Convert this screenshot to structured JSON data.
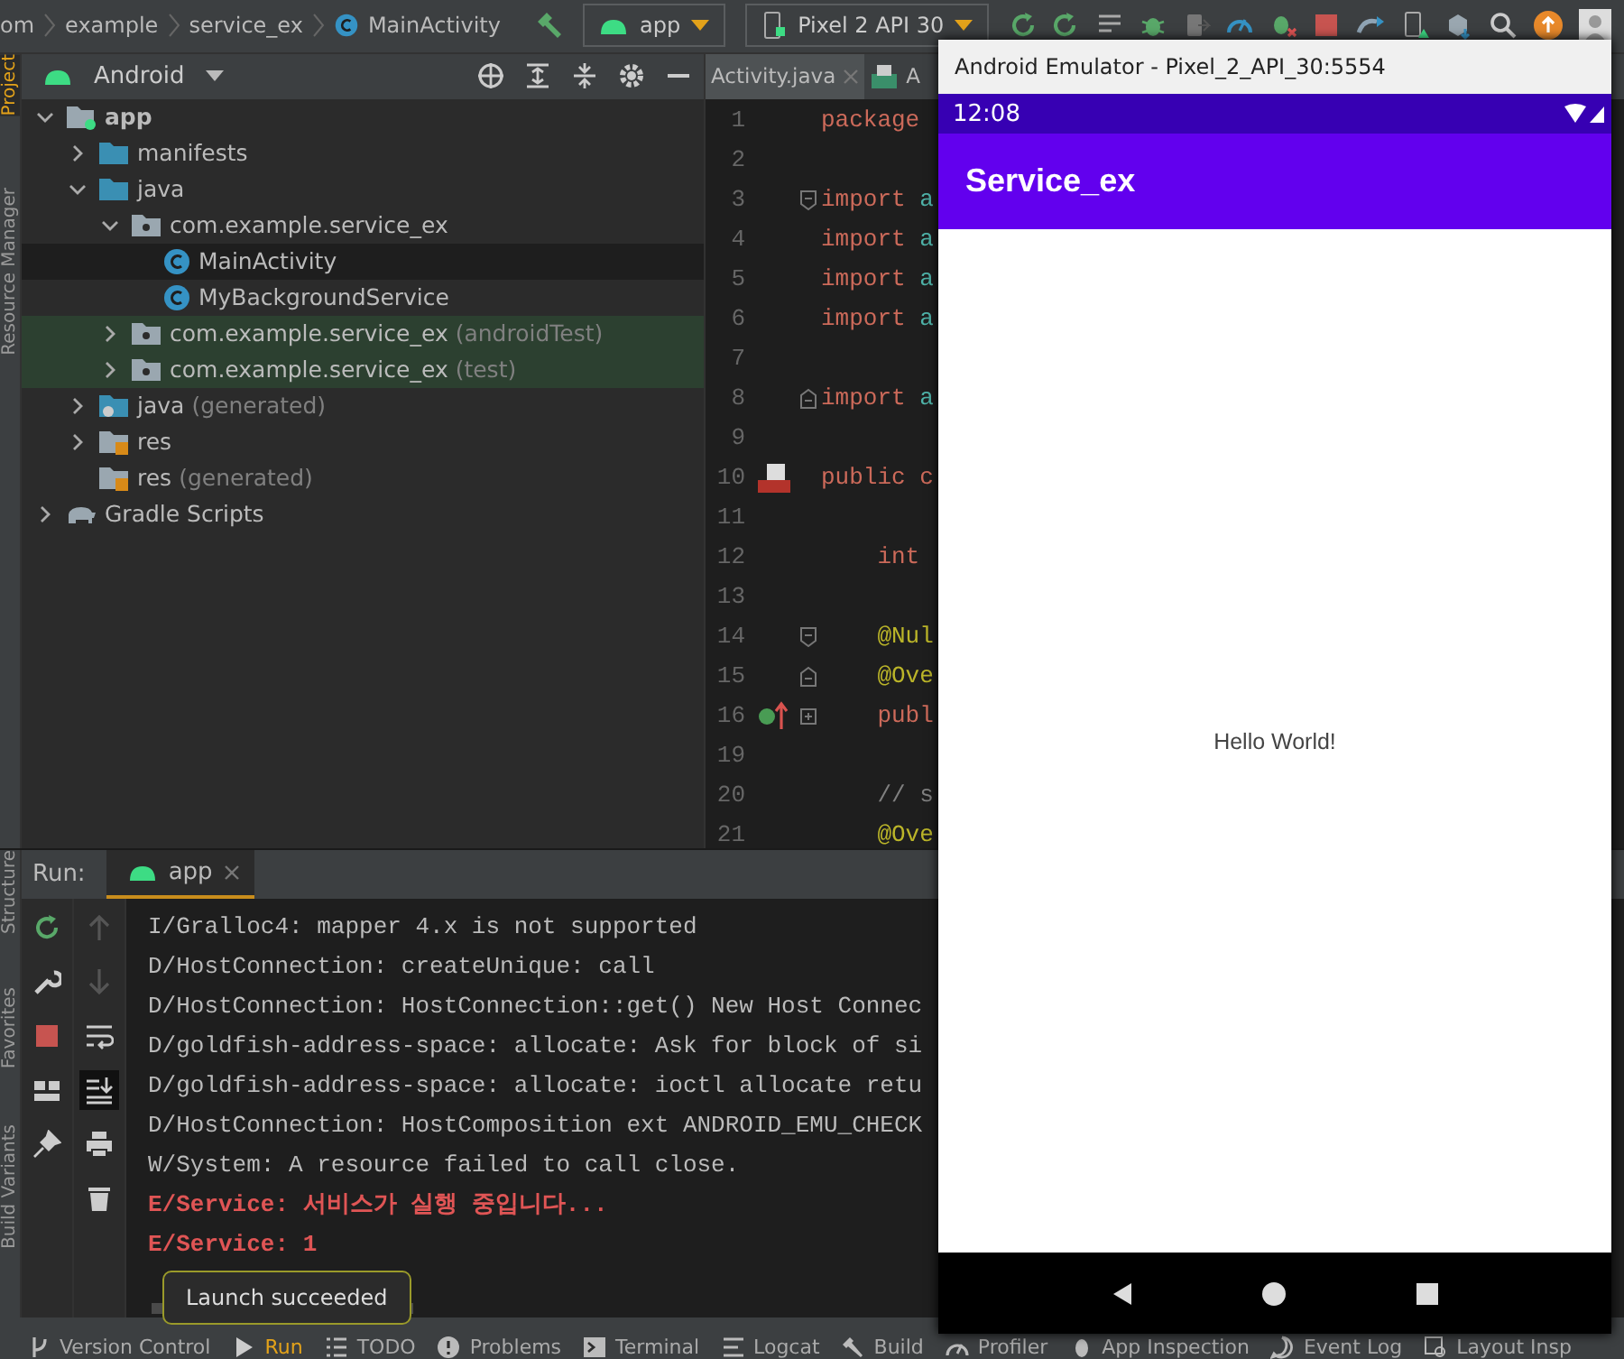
{
  "breadcrumbs": [
    "om",
    "example",
    "service_ex",
    "MainActivity"
  ],
  "run_config": {
    "label": "app"
  },
  "device": {
    "label": "Pixel 2 API 30"
  },
  "left_stripe": [
    {
      "label": "Project",
      "selected": true
    },
    {
      "label": "Resource Manager",
      "selected": false
    }
  ],
  "project": {
    "view": "Android",
    "tree": [
      {
        "label": "app",
        "kind": "module",
        "expanded": true,
        "selected": false,
        "tinted": false,
        "children": [
          {
            "label": "manifests",
            "kind": "folder",
            "expanded": false,
            "selected": false,
            "tinted": false
          },
          {
            "label": "java",
            "kind": "folder",
            "expanded": true,
            "selected": false,
            "tinted": false,
            "children": [
              {
                "label": "com.example.service_ex",
                "kind": "package",
                "expanded": true,
                "selected": false,
                "tinted": false,
                "children": [
                  {
                    "label": "MainActivity",
                    "kind": "class",
                    "selected": true,
                    "tinted": false
                  },
                  {
                    "label": "MyBackgroundService",
                    "kind": "class",
                    "selected": false,
                    "tinted": false
                  }
                ]
              },
              {
                "label": "com.example.service_ex",
                "suffix": "(androidTest)",
                "kind": "package",
                "expanded": false,
                "selected": false,
                "tinted": true
              },
              {
                "label": "com.example.service_ex",
                "suffix": "(test)",
                "kind": "package",
                "expanded": false,
                "selected": false,
                "tinted": true
              }
            ]
          },
          {
            "label": "java",
            "suffix": "(generated)",
            "kind": "generated",
            "expanded": false,
            "selected": false,
            "tinted": false
          },
          {
            "label": "res",
            "kind": "res",
            "expanded": false,
            "selected": false,
            "tinted": false
          },
          {
            "label": "res",
            "suffix": "(generated)",
            "kind": "res",
            "selected": false,
            "tinted": false
          }
        ]
      },
      {
        "label": "Gradle Scripts",
        "kind": "gradle",
        "expanded": false,
        "selected": false,
        "tinted": false
      }
    ]
  },
  "editor": {
    "tabs": [
      {
        "label": "Activity.java",
        "selected": true
      },
      {
        "label": "A",
        "selected": false
      }
    ],
    "lines": [
      {
        "number": "1",
        "tokens": [
          {
            "kind": "keyword",
            "text": "package"
          }
        ]
      },
      {
        "number": "2"
      },
      {
        "number": "3",
        "markers": [
          {
            "kind": "fold-start"
          }
        ],
        "tokens": [
          {
            "kind": "keyword",
            "text": "import"
          },
          {
            "kind": "ident",
            "text": " a"
          }
        ]
      },
      {
        "number": "4",
        "tokens": [
          {
            "kind": "keyword",
            "text": "import"
          },
          {
            "kind": "ident",
            "text": " a"
          }
        ]
      },
      {
        "number": "5",
        "tokens": [
          {
            "kind": "keyword",
            "text": "import"
          },
          {
            "kind": "ident",
            "text": " a"
          }
        ]
      },
      {
        "number": "6",
        "tokens": [
          {
            "kind": "keyword",
            "text": "import"
          },
          {
            "kind": "ident",
            "text": " a"
          }
        ]
      },
      {
        "number": "7"
      },
      {
        "number": "8",
        "markers": [
          {
            "kind": "fold-end"
          }
        ],
        "tokens": [
          {
            "kind": "keyword",
            "text": "import"
          },
          {
            "kind": "ident",
            "text": " a"
          }
        ]
      },
      {
        "number": "9"
      },
      {
        "number": "10",
        "markers": [
          {
            "kind": "layout"
          }
        ],
        "tokens": [
          {
            "kind": "keyword",
            "text": "public c"
          }
        ]
      },
      {
        "number": "11"
      },
      {
        "number": "12",
        "tokens": [
          {
            "kind": "keyword",
            "text": "    int"
          }
        ]
      },
      {
        "number": "13"
      },
      {
        "number": "14",
        "markers": [
          {
            "kind": "fold-start"
          }
        ],
        "tokens": [
          {
            "kind": "annotation",
            "text": "    @Nul"
          }
        ]
      },
      {
        "number": "15",
        "markers": [
          {
            "kind": "fold-end"
          }
        ],
        "tokens": [
          {
            "kind": "annotation",
            "text": "    @Ove"
          }
        ]
      },
      {
        "number": "16",
        "markers": [
          {
            "kind": "override"
          },
          {
            "kind": "fold-plus"
          }
        ],
        "tokens": [
          {
            "kind": "keyword",
            "text": "    publ"
          }
        ]
      },
      {
        "number": "19"
      },
      {
        "number": "20",
        "tokens": [
          {
            "kind": "comment",
            "text": "    // s"
          }
        ]
      },
      {
        "number": "21",
        "tokens": [
          {
            "kind": "annotation",
            "text": "    @Ove"
          }
        ]
      }
    ]
  },
  "run_panel": {
    "title": "Run:",
    "tabs": [
      {
        "label": "app",
        "selected": true
      }
    ],
    "console": [
      {
        "kind": "info",
        "text": "I/Gralloc4: mapper 4.x is not supported"
      },
      {
        "kind": "info",
        "text": "D/HostConnection: createUnique: call"
      },
      {
        "kind": "info",
        "text": "D/HostConnection: HostConnection::get() New Host Connec"
      },
      {
        "kind": "info",
        "text": "D/goldfish-address-space: allocate: Ask for block of si"
      },
      {
        "kind": "info",
        "text": "D/goldfish-address-space: allocate: ioctl allocate retu"
      },
      {
        "kind": "info",
        "text": "D/HostConnection: HostComposition ext ANDROID_EMU_CHECK"
      },
      {
        "kind": "info",
        "text": "W/System: A resource failed to call close."
      },
      {
        "kind": "error",
        "text": "E/Service: 서비스가 실행 중입니다..."
      },
      {
        "kind": "error",
        "text": "E/Service: 1"
      }
    ]
  },
  "bottom_stripe": [
    {
      "label": "Structure",
      "selected": false
    },
    {
      "label": "Favorites",
      "selected": false
    },
    {
      "label": "Build Variants",
      "selected": false
    }
  ],
  "tooltip": "Launch succeeded",
  "tool_windows": [
    {
      "label": "Version Control",
      "selected": false
    },
    {
      "label": "Run",
      "selected": true
    },
    {
      "label": "TODO",
      "selected": false
    },
    {
      "label": "Problems",
      "selected": false
    },
    {
      "label": "Terminal",
      "selected": false
    },
    {
      "label": "Logcat",
      "selected": false
    },
    {
      "label": "Build",
      "selected": false
    },
    {
      "label": "Profiler",
      "selected": false
    },
    {
      "label": "App Inspection",
      "selected": false
    },
    {
      "label": "Event Log",
      "selected": false
    },
    {
      "label": "Layout Insp",
      "selected": false
    }
  ],
  "emulator": {
    "title": "Android Emulator - Pixel_2_API_30:5554",
    "time": "12:08",
    "app_title": "Service_ex",
    "body_text": "Hello World!"
  }
}
